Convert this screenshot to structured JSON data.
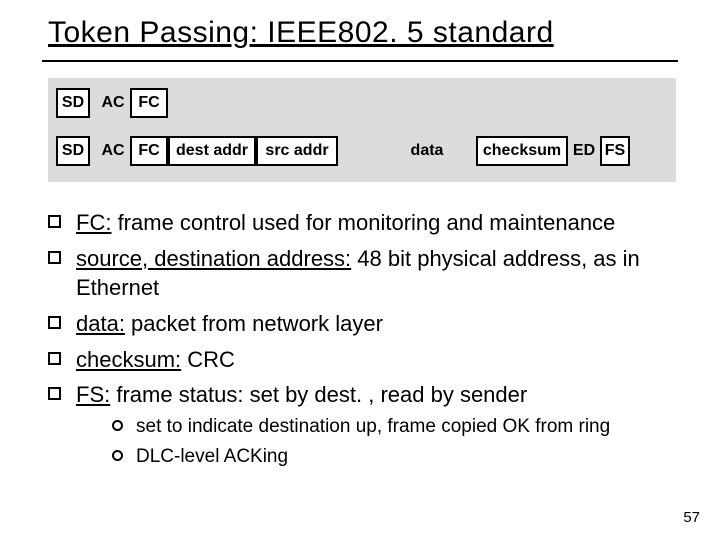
{
  "title": "Token Passing: IEEE802. 5 standard",
  "diagram": {
    "row1": {
      "sd": "SD",
      "ac": "AC",
      "fc": "FC"
    },
    "row2": {
      "sd": "SD",
      "ac": "AC",
      "fc": "FC",
      "dest": "dest addr",
      "src": "src addr",
      "data": "data",
      "checksum": "checksum",
      "ed": "ED",
      "fs": "FS"
    }
  },
  "bullets": {
    "b1_lead": "FC:",
    "b1_rest": " frame control used for monitoring and maintenance",
    "b2_lead": "source, destination address:",
    "b2_rest": " 48 bit physical address, as in Ethernet",
    "b3_lead": "data:",
    "b3_rest": " packet from network layer",
    "b4_lead": "checksum:",
    "b4_rest": " CRC",
    "b5_lead": "FS:",
    "b5_rest": " frame status: set by dest. , read by sender",
    "sub1": "set to indicate destination up, frame copied OK from ring",
    "sub2": "DLC-level ACKing"
  },
  "page_number": "57"
}
